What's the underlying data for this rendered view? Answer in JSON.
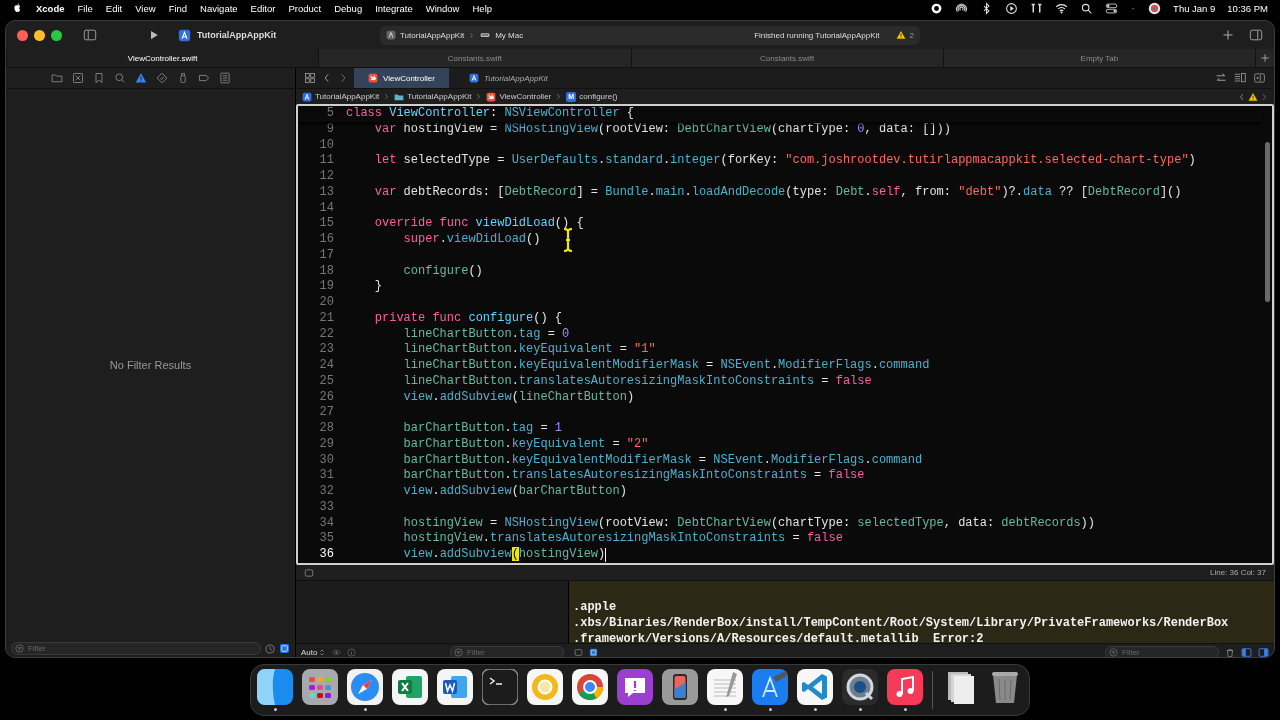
{
  "menu_bar": {
    "app": "Xcode",
    "items": [
      "File",
      "Edit",
      "View",
      "Find",
      "Navigate",
      "Editor",
      "Product",
      "Debug",
      "Integrate",
      "Window",
      "Help"
    ],
    "date": "Thu Jan 9",
    "time": "10:36 PM"
  },
  "toolbar": {
    "project": "TutorialAppAppKit",
    "scheme": "TutorialAppAppKit",
    "destination": "My Mac",
    "status": "Finished running TutorialAppAppKit",
    "warnings": "2"
  },
  "tabs": [
    {
      "label": "ViewController.swift",
      "selected": true
    },
    {
      "label": "Constants.swift",
      "selected": false
    },
    {
      "label": "Constants.swift",
      "selected": false
    },
    {
      "label": "Empty Tab",
      "selected": false
    }
  ],
  "navigator": {
    "tabs": [
      {
        "kind": "folder",
        "selected": false
      },
      {
        "kind": "source",
        "selected": false
      },
      {
        "kind": "bookmark",
        "selected": false
      },
      {
        "kind": "search",
        "selected": false
      },
      {
        "kind": "issue",
        "selected": true
      },
      {
        "kind": "test",
        "selected": false
      },
      {
        "kind": "debug",
        "selected": false
      },
      {
        "kind": "breakpoint",
        "selected": false
      },
      {
        "kind": "report",
        "selected": false
      }
    ],
    "message": "No Filter Results",
    "filter_placeholder": "Filter"
  },
  "editor": {
    "tabs": [
      {
        "label": "ViewController",
        "kind": "swift",
        "selected": true,
        "preview": false
      },
      {
        "label": "TutorialAppAppKit",
        "kind": "project",
        "selected": false,
        "preview": true
      }
    ],
    "breadcrumb": [
      {
        "label": "TutorialAppAppKit",
        "kind": "project"
      },
      {
        "label": "TutorialAppAppKit",
        "kind": "folder"
      },
      {
        "label": "ViewController",
        "kind": "swift"
      },
      {
        "label": "configure()",
        "kind": "method",
        "badge": "M"
      }
    ],
    "sticky_line": {
      "number": "5",
      "tokens": [
        {
          "kind": "kw",
          "text": "class"
        },
        {
          "kind": "decl",
          "text": " ViewController"
        },
        {
          "kind": "p",
          "text": ":"
        },
        {
          "kind": "sys",
          "text": " NSViewController"
        },
        {
          "kind": "p",
          "text": " {"
        }
      ]
    },
    "lines": [
      {
        "number": "9",
        "current": false,
        "tokens": [
          {
            "kind": "kw",
            "text": "var"
          },
          {
            "kind": "p",
            "text": " hostingView ="
          },
          {
            "kind": "sys",
            "text": " NSHostingView"
          },
          {
            "kind": "p",
            "text": "(rootView:"
          },
          {
            "kind": "proj",
            "text": " DebtChartView"
          },
          {
            "kind": "p",
            "text": "(chartType:"
          },
          {
            "kind": "num",
            "text": " 0"
          },
          {
            "kind": "p",
            "text": ", data: []))"
          }
        ]
      },
      {
        "number": "10",
        "current": false
      },
      {
        "number": "11",
        "current": false,
        "tokens": [
          {
            "kind": "kw",
            "text": "let"
          },
          {
            "kind": "p",
            "text": " selectedType ="
          },
          {
            "kind": "sys",
            "text": " UserDefaults"
          },
          {
            "kind": "p",
            "text": "."
          },
          {
            "kind": "sys",
            "text": "standard"
          },
          {
            "kind": "p",
            "text": "."
          },
          {
            "kind": "sys",
            "text": "integer"
          },
          {
            "kind": "p",
            "text": "(forKey:"
          },
          {
            "kind": "str",
            "text": " \"com.joshrootdev.tutirlappmacappkit.selected-chart-type\""
          },
          {
            "kind": "p",
            "text": ")"
          }
        ]
      },
      {
        "number": "12",
        "current": false
      },
      {
        "number": "13",
        "current": false,
        "tokens": [
          {
            "kind": "kw",
            "text": "var"
          },
          {
            "kind": "p",
            "text": " debtRecords: ["
          },
          {
            "kind": "proj",
            "text": "DebtRecord"
          },
          {
            "kind": "p",
            "text": "] ="
          },
          {
            "kind": "sys",
            "text": " Bundle"
          },
          {
            "kind": "p",
            "text": "."
          },
          {
            "kind": "sys",
            "text": "main"
          },
          {
            "kind": "p",
            "text": "."
          },
          {
            "kind": "sys",
            "text": "loadAndDecode"
          },
          {
            "kind": "p",
            "text": "(type:"
          },
          {
            "kind": "proj",
            "text": " Debt"
          },
          {
            "kind": "p",
            "text": "."
          },
          {
            "kind": "kw",
            "text": "self"
          },
          {
            "kind": "p",
            "text": ", from:"
          },
          {
            "kind": "str",
            "text": " \"debt\""
          },
          {
            "kind": "p",
            "text": ")?."
          },
          {
            "kind": "sys",
            "text": "data"
          },
          {
            "kind": "p",
            "text": " ?? ["
          },
          {
            "kind": "proj",
            "text": "DebtRecord"
          },
          {
            "kind": "p",
            "text": "]()"
          }
        ]
      },
      {
        "number": "14",
        "current": false
      },
      {
        "number": "15",
        "current": false,
        "tokens": [
          {
            "kind": "kw",
            "text": "override"
          },
          {
            "kind": "kw",
            "text": " func"
          },
          {
            "kind": "decl",
            "text": " viewDidLoad"
          },
          {
            "kind": "p",
            "text": "() {"
          }
        ],
        "children": [
          {
            "number": "16",
            "current": false,
            "tokens": [
              {
                "kind": "kw",
                "text": "super"
              },
              {
                "kind": "p",
                "text": "."
              },
              {
                "kind": "sys",
                "text": "viewDidLoad"
              },
              {
                "kind": "p",
                "text": "()"
              }
            ]
          },
          {
            "number": "17",
            "current": false
          },
          {
            "number": "18",
            "current": false,
            "tokens": [
              {
                "kind": "proj",
                "text": "configure"
              },
              {
                "kind": "p",
                "text": "()"
              }
            ]
          }
        ]
      },
      {
        "number": "19",
        "current": false,
        "tokens": [
          {
            "kind": "p",
            "text": "}"
          }
        ]
      },
      {
        "number": "20",
        "current": false
      },
      {
        "number": "21",
        "current": false,
        "tokens": [
          {
            "kind": "kw",
            "text": "private"
          },
          {
            "kind": "kw",
            "text": " func"
          },
          {
            "kind": "decl",
            "text": " configure"
          },
          {
            "kind": "p",
            "text": "() {"
          }
        ],
        "children": [
          {
            "number": "22",
            "current": false,
            "tokens": [
              {
                "kind": "proj",
                "text": "lineChartButton"
              },
              {
                "kind": "p",
                "text": "."
              },
              {
                "kind": "sys",
                "text": "tag"
              },
              {
                "kind": "p",
                "text": " ="
              },
              {
                "kind": "num",
                "text": " 0"
              }
            ]
          },
          {
            "number": "23",
            "current": false,
            "tokens": [
              {
                "kind": "proj",
                "text": "lineChartButton"
              },
              {
                "kind": "p",
                "text": "."
              },
              {
                "kind": "sys",
                "text": "keyEquivalent"
              },
              {
                "kind": "p",
                "text": " ="
              },
              {
                "kind": "str",
                "text": " \"1\""
              }
            ]
          },
          {
            "number": "24",
            "current": false,
            "tokens": [
              {
                "kind": "proj",
                "text": "lineChartButton"
              },
              {
                "kind": "p",
                "text": "."
              },
              {
                "kind": "sys",
                "text": "keyEquivalentModifierMask"
              },
              {
                "kind": "p",
                "text": " ="
              },
              {
                "kind": "sys",
                "text": " NSEvent"
              },
              {
                "kind": "p",
                "text": "."
              },
              {
                "kind": "sys",
                "text": "ModifierFlags"
              },
              {
                "kind": "p",
                "text": "."
              },
              {
                "kind": "sys",
                "text": "command"
              }
            ]
          },
          {
            "number": "25",
            "current": false,
            "tokens": [
              {
                "kind": "proj",
                "text": "lineChartButton"
              },
              {
                "kind": "p",
                "text": "."
              },
              {
                "kind": "sys",
                "text": "translatesAutoresizingMaskIntoConstraints"
              },
              {
                "kind": "p",
                "text": " ="
              },
              {
                "kind": "kw",
                "text": " false"
              }
            ]
          },
          {
            "number": "26",
            "current": false,
            "tokens": [
              {
                "kind": "sys",
                "text": "view"
              },
              {
                "kind": "p",
                "text": "."
              },
              {
                "kind": "sys",
                "text": "addSubview"
              },
              {
                "kind": "p",
                "text": "("
              },
              {
                "kind": "proj",
                "text": "lineChartButton"
              },
              {
                "kind": "p",
                "text": ")"
              }
            ]
          },
          {
            "number": "27",
            "current": false
          },
          {
            "number": "28",
            "current": false,
            "tokens": [
              {
                "kind": "proj",
                "text": "barChartButton"
              },
              {
                "kind": "p",
                "text": "."
              },
              {
                "kind": "sys",
                "text": "tag"
              },
              {
                "kind": "p",
                "text": " ="
              },
              {
                "kind": "num",
                "text": " 1"
              }
            ]
          },
          {
            "number": "29",
            "current": false,
            "tokens": [
              {
                "kind": "proj",
                "text": "barChartButton"
              },
              {
                "kind": "p",
                "text": "."
              },
              {
                "kind": "sys",
                "text": "keyEquivalent"
              },
              {
                "kind": "p",
                "text": " ="
              },
              {
                "kind": "str",
                "text": " \"2\""
              }
            ]
          },
          {
            "number": "30",
            "current": false,
            "tokens": [
              {
                "kind": "proj",
                "text": "barChartButton"
              },
              {
                "kind": "p",
                "text": "."
              },
              {
                "kind": "sys",
                "text": "keyEquivalentModifierMask"
              },
              {
                "kind": "p",
                "text": " ="
              },
              {
                "kind": "sys",
                "text": " NSEvent"
              },
              {
                "kind": "p",
                "text": "."
              },
              {
                "kind": "sys",
                "text": "ModifierFlags"
              },
              {
                "kind": "p",
                "text": "."
              },
              {
                "kind": "sys",
                "text": "command"
              }
            ]
          },
          {
            "number": "31",
            "current": false,
            "tokens": [
              {
                "kind": "proj",
                "text": "barChartButton"
              },
              {
                "kind": "p",
                "text": "."
              },
              {
                "kind": "sys",
                "text": "translatesAutoresizingMaskIntoConstraints"
              },
              {
                "kind": "p",
                "text": " ="
              },
              {
                "kind": "kw",
                "text": " false"
              }
            ]
          },
          {
            "number": "32",
            "current": false,
            "tokens": [
              {
                "kind": "sys",
                "text": "view"
              },
              {
                "kind": "p",
                "text": "."
              },
              {
                "kind": "sys",
                "text": "addSubview"
              },
              {
                "kind": "p",
                "text": "("
              },
              {
                "kind": "proj",
                "text": "barChartButton"
              },
              {
                "kind": "p",
                "text": ")"
              }
            ]
          },
          {
            "number": "33",
            "current": false
          },
          {
            "number": "34",
            "current": false,
            "tokens": [
              {
                "kind": "proj",
                "text": "hostingView"
              },
              {
                "kind": "p",
                "text": " ="
              },
              {
                "kind": "sys",
                "text": " NSHostingView"
              },
              {
                "kind": "p",
                "text": "(rootView:"
              },
              {
                "kind": "proj",
                "text": " DebtChartView"
              },
              {
                "kind": "p",
                "text": "(chartType:"
              },
              {
                "kind": "proj",
                "text": " selectedType"
              },
              {
                "kind": "p",
                "text": ", data:"
              },
              {
                "kind": "proj",
                "text": " debtRecords"
              },
              {
                "kind": "p",
                "text": "))"
              }
            ]
          },
          {
            "number": "35",
            "current": false,
            "tokens": [
              {
                "kind": "proj",
                "text": "hostingView"
              },
              {
                "kind": "p",
                "text": "."
              },
              {
                "kind": "sys",
                "text": "translatesAutoresizingMaskIntoConstraints"
              },
              {
                "kind": "p",
                "text": " ="
              },
              {
                "kind": "kw",
                "text": " false"
              }
            ]
          },
          {
            "number": "36",
            "current": true,
            "tokens": [
              {
                "kind": "sys",
                "text": "view"
              },
              {
                "kind": "p",
                "text": "."
              },
              {
                "kind": "sys",
                "text": "addSubview"
              },
              {
                "kind": "match",
                "text": "("
              },
              {
                "kind": "proj",
                "text": "hostingView"
              },
              {
                "kind": "p",
                "text": ")"
              }
            ]
          }
        ]
      }
    ],
    "position": "Line: 36 Col: 37"
  },
  "debug": {
    "scope": "Auto",
    "filter_placeholder": "Filter",
    "console": [
      ".apple",
      ".xbs/Binaries/RenderBox/install/TempContent/Root/System/Library/PrivateFrameworks/RenderBox",
      ".framework/Versions/A/Resources/default.metallib  Error:2"
    ],
    "console_filter_placeholder": "Filter"
  },
  "dock": [
    {
      "kind": "finder",
      "running": true
    },
    {
      "kind": "grid",
      "running": false
    },
    {
      "kind": "compass",
      "running": true
    },
    {
      "kind": "sheet",
      "running": false
    },
    {
      "kind": "doc",
      "running": false
    },
    {
      "kind": "terminal",
      "running": false
    },
    {
      "kind": "ring",
      "running": false
    },
    {
      "kind": "wheel",
      "running": false
    },
    {
      "kind": "bubble",
      "running": false
    },
    {
      "kind": "phone",
      "running": false
    },
    {
      "kind": "notepad",
      "running": true
    },
    {
      "kind": "hammer",
      "running": true
    },
    {
      "kind": "ribbon",
      "running": true
    },
    {
      "kind": "player",
      "running": true
    },
    {
      "kind": "note",
      "running": true
    },
    {
      "kind": "separator"
    },
    {
      "kind": "stack",
      "running": false
    },
    {
      "kind": "trash",
      "running": false
    }
  ]
}
